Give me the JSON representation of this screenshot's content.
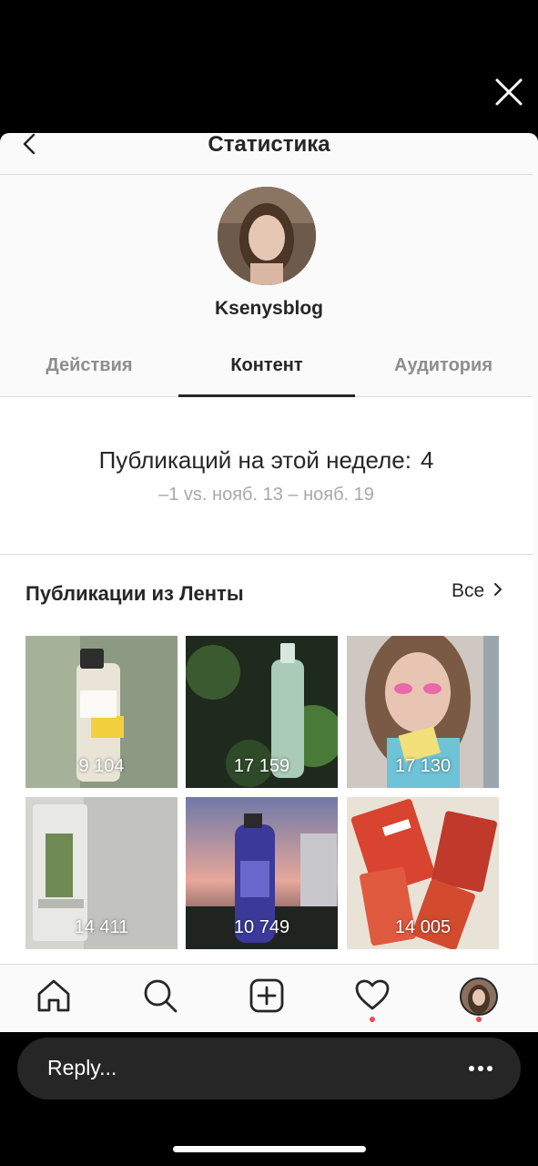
{
  "header": {
    "title": "Статистика"
  },
  "profile": {
    "username": "Ksenysblog"
  },
  "tabs": [
    {
      "label": "Действия",
      "active": false
    },
    {
      "label": "Контент",
      "active": true
    },
    {
      "label": "Аудитория",
      "active": false
    }
  ],
  "weekly_stats": {
    "label": "Публикаций на этой неделе:",
    "value": "4",
    "comparison": "–1 vs. нояб. 13 – нояб. 19"
  },
  "feed_posts": {
    "title": "Публикации из Ленты",
    "see_all_label": "Все",
    "posts": [
      {
        "count": "9 104"
      },
      {
        "count": "17 159"
      },
      {
        "count": "17 130"
      },
      {
        "count": "14 411"
      },
      {
        "count": "10 749"
      },
      {
        "count": "14 005"
      }
    ]
  },
  "bottom_nav": {
    "items": [
      "home-icon",
      "search-icon",
      "add-post-icon",
      "activity-heart-icon",
      "profile-avatar"
    ],
    "notification_color": "#ed4956"
  },
  "reply": {
    "placeholder": "Reply..."
  },
  "colors": {
    "primary_text": "#262626",
    "secondary_text": "#8e8e8e",
    "divider": "#dbdbdb",
    "reply_bar": "#262626"
  }
}
